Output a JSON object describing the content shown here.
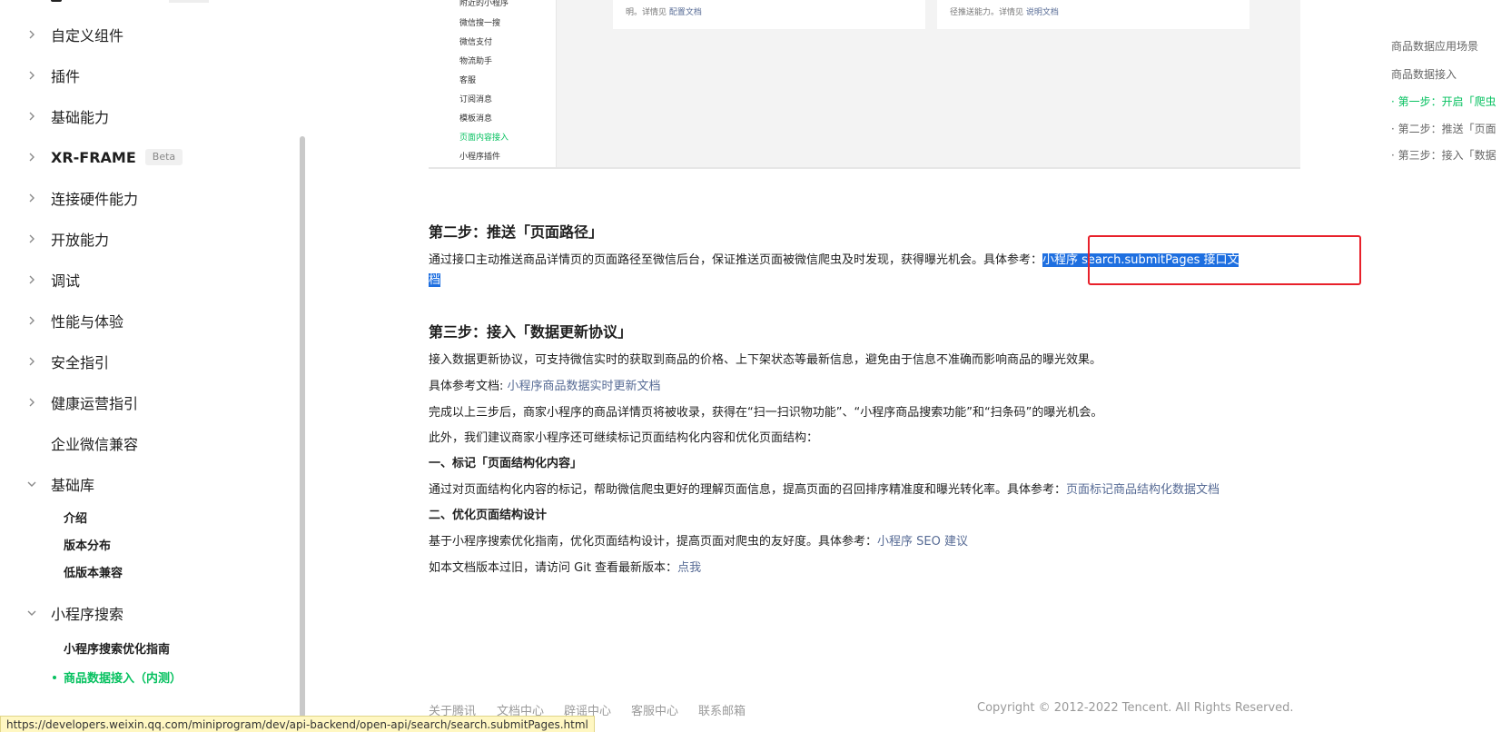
{
  "sidebar": {
    "items": [
      {
        "label": "自定义组件"
      },
      {
        "label": "插件"
      },
      {
        "label": "基础能力"
      },
      {
        "label": "XR-FRAME",
        "badge": "Beta"
      },
      {
        "label": "连接硬件能力"
      },
      {
        "label": "开放能力"
      },
      {
        "label": "调试"
      },
      {
        "label": "性能与体验"
      },
      {
        "label": "安全指引"
      },
      {
        "label": "健康运营指引"
      },
      {
        "label": "企业微信兼容"
      },
      {
        "label": "基础库"
      },
      {
        "label": "小程序搜索"
      }
    ],
    "basic_lib_children": [
      "介绍",
      "版本分布",
      "低版本兼容"
    ],
    "search_children": [
      "小程序搜索优化指南",
      "商品数据接入（内测）"
    ]
  },
  "embed": {
    "side_items": [
      "附近的小程序",
      "微信搜一搜",
      "微信支付",
      "物流助手",
      "客服",
      "订阅消息",
      "模板消息",
      "页面内容接入",
      "小程序插件"
    ],
    "card1_prefix": "明。详情见",
    "card1_link": "配置文档",
    "card2_prefix": "径推送能力。详情见",
    "card2_link": "说明文档"
  },
  "content": {
    "step2_title": "第二步：推送「页面路径」",
    "step2_text": "通过接口主动推送商品详情页的页面路径至微信后台，保证推送页面被微信爬虫及时发现，获得曝光机会。具体参考：",
    "step2_link_a": "小程序 search.submitPages 接口文",
    "step2_link_b": "档",
    "step3_title": "第三步：接入「数据更新协议」",
    "step3_text": "接入数据更新协议，可支持微信实时的获取到商品的价格、上下架状态等最新信息，避免由于信息不准确而影响商品的曝光效果。",
    "ref_prefix": "具体参考文档: ",
    "ref_link": "小程序商品数据实时更新文档",
    "complete_text": "完成以上三步后，商家小程序的商品详情页将被收录，获得在“扫一扫识物功能”、“小程序商品搜索功能”和“扫条码”的曝光机会。",
    "suggest_text": "此外，我们建议商家小程序还可继续标记页面结构化内容和优化页面结构：",
    "mark_title": "一、标记「页面结构化内容」",
    "mark_text": "通过对页面结构化内容的标记，帮助微信爬虫更好的理解页面信息，提高页面的召回排序精准度和曝光转化率。具体参考：",
    "mark_link": "页面标记商品结构化数据文档",
    "opt_title": "二、优化页面结构设计",
    "opt_text": "基于小程序搜索优化指南，优化页面结构设计，提高页面对爬虫的友好度。具体参考：",
    "opt_link": "小程序 SEO 建议",
    "git_text": "如本文档版本过旧，请访问 Git 查看最新版本：",
    "git_link": "点我"
  },
  "footer": {
    "links": [
      "关于腾讯",
      "文档中心",
      "辟谣中心",
      "客服中心",
      "联系邮箱"
    ],
    "copyright": "Copyright © 2012-2022 Tencent. All Rights Reserved."
  },
  "toc": {
    "items": [
      "商品数据应用场景",
      "商品数据接入",
      "· 第一步：开启「爬虫",
      "· 第二步：推送「页面",
      "· 第三步：接入「数据"
    ]
  },
  "status_url": "https://developers.weixin.qq.com/miniprogram/dev/api-backend/open-api/search/search.submitPages.html",
  "colors": {
    "accent": "#07c160",
    "link": "#576b95",
    "selection": "#1e6fe0",
    "highlight_box": "#e8202a"
  }
}
